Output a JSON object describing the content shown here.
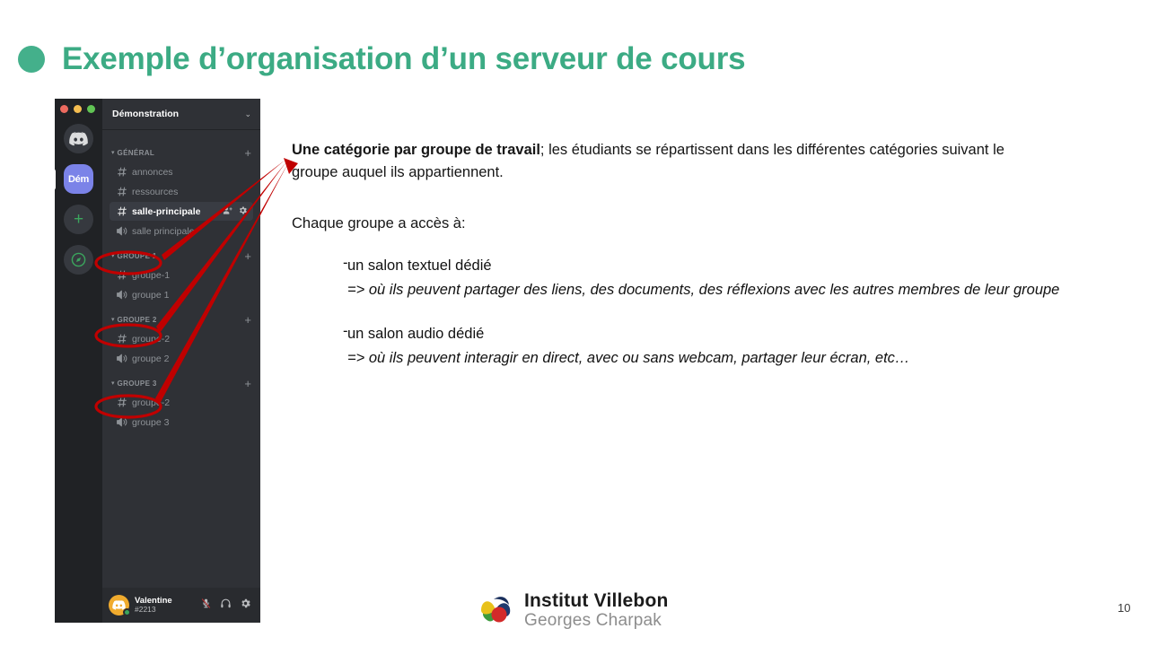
{
  "slide": {
    "title": "Exemple d’organisation d’un serveur de cours",
    "page_number": "10",
    "accent_color": "#3cab84",
    "bullet_color": "#44b08b",
    "annotation_color": "#c00000"
  },
  "discord": {
    "traffic_lights": [
      "close-red",
      "minimize-yellow",
      "maximize-green"
    ],
    "rail": [
      {
        "name": "discord-home",
        "label": ""
      },
      {
        "name": "server-dem",
        "label": "Dém"
      },
      {
        "name": "add-server",
        "label": "+"
      },
      {
        "name": "explore-servers",
        "label": ""
      }
    ],
    "server_name": "Démonstration",
    "server_chevron": "⌄",
    "categories": [
      {
        "label": "GÉNÉRAL",
        "add_label": "+",
        "channels": [
          {
            "type": "text",
            "name": "annonces",
            "active": false
          },
          {
            "type": "text",
            "name": "ressources",
            "active": false
          },
          {
            "type": "text",
            "name": "salle-principale",
            "active": true
          },
          {
            "type": "voice",
            "name": "salle principale",
            "active": false
          }
        ]
      },
      {
        "label": "GROUPE 1",
        "add_label": "+",
        "channels": [
          {
            "type": "text",
            "name": "groupe-1",
            "active": false
          },
          {
            "type": "voice",
            "name": "groupe 1",
            "active": false
          }
        ]
      },
      {
        "label": "GROUPE 2",
        "add_label": "+",
        "channels": [
          {
            "type": "text",
            "name": "groupe-2",
            "active": false
          },
          {
            "type": "voice",
            "name": "groupe 2",
            "active": false
          }
        ]
      },
      {
        "label": "GROUPE 3",
        "add_label": "+",
        "channels": [
          {
            "type": "text",
            "name": "groupe-2",
            "active": false
          },
          {
            "type": "voice",
            "name": "groupe 3",
            "active": false
          }
        ]
      }
    ],
    "user": {
      "name": "Valentine",
      "tag": "#2213",
      "status": "online",
      "actions": [
        "microphone-muted-icon",
        "headphones-icon",
        "user-settings-gear-icon"
      ]
    }
  },
  "content": {
    "intro_bold": "Une catégorie par groupe de travail",
    "intro_rest": "; les étudiants se répartissent dans les différentes catégories suivant le groupe auquel ils appartiennent.",
    "access_line": "Chaque groupe a accès à:",
    "bullets": [
      {
        "dash": "-",
        "title": "un salon textuel dédié",
        "sub": "=> où ils peuvent partager des liens, des documents, des réflexions avec les autres membres de leur groupe"
      },
      {
        "dash": "-",
        "title": "un salon audio dédié",
        "sub": " => où ils peuvent interagir en direct, avec ou sans webcam, partager leur écran, etc…"
      }
    ]
  },
  "footer": {
    "logo_line1": "Institut Villebon",
    "logo_line2": "Georges Charpak",
    "logo_colors": {
      "blue": "#1f3a6e",
      "red": "#d32a2a",
      "green": "#3d9a3d",
      "yellow": "#e8c11a"
    }
  }
}
